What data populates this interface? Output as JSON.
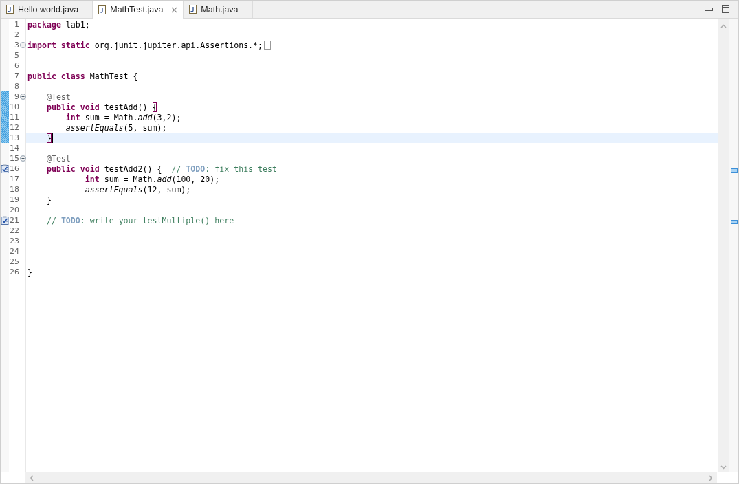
{
  "tabs": [
    {
      "label": "Hello world.java",
      "selected": false,
      "closable": false
    },
    {
      "label": "MathTest.java",
      "selected": true,
      "closable": true
    },
    {
      "label": "Math.java",
      "selected": false,
      "closable": false
    }
  ],
  "editor": {
    "lines": [
      {
        "number": "1",
        "tokens": [
          {
            "t": "package",
            "kind": "kw"
          },
          {
            "t": " lab1;",
            "kind": "plain"
          }
        ]
      },
      {
        "number": "2"
      },
      {
        "number": "3",
        "gutter": {
          "kind": "fold-collapsed"
        },
        "folded": true,
        "tokens": [
          {
            "t": "import",
            "kind": "kw"
          },
          {
            "t": " static",
            "kind": "kw"
          },
          {
            "t": " org.junit.jupiter.api.Assertions.*;",
            "kind": "plain"
          }
        ]
      },
      {
        "number": "5"
      },
      {
        "number": "6"
      },
      {
        "number": "7",
        "tokens": [
          {
            "t": "public",
            "kind": "kw"
          },
          {
            "t": " class",
            "kind": "kw"
          },
          {
            "t": " MathTest {",
            "kind": "plain"
          }
        ]
      },
      {
        "number": "8"
      },
      {
        "number": "9",
        "gutter": {
          "kind": "fold-expanded"
        },
        "changed": true,
        "tokens": [
          {
            "t": "    @Test",
            "kind": "ann"
          }
        ]
      },
      {
        "number": "10",
        "changed": true,
        "tokens": [
          {
            "t": "    public",
            "kind": "kw"
          },
          {
            "t": " void",
            "kind": "kw"
          },
          {
            "t": " testAdd() ",
            "kind": "plain"
          },
          {
            "t": "{",
            "kind": "bracket"
          }
        ]
      },
      {
        "number": "11",
        "changed": true,
        "tokens": [
          {
            "t": "        int",
            "kind": "kw"
          },
          {
            "t": " sum = Math.",
            "kind": "plain"
          },
          {
            "t": "add",
            "kind": "static"
          },
          {
            "t": "(3,2);",
            "kind": "plain"
          }
        ]
      },
      {
        "number": "12",
        "changed": true,
        "tokens": [
          {
            "t": "        assertEquals",
            "kind": "static"
          },
          {
            "t": "(5, sum);",
            "kind": "plain"
          }
        ]
      },
      {
        "number": "13",
        "changed": true,
        "current": true,
        "cursor": true,
        "tokens": [
          {
            "t": "    }",
            "kind": "bracket"
          }
        ]
      },
      {
        "number": "14"
      },
      {
        "number": "15",
        "gutter": {
          "kind": "fold-expanded"
        },
        "tokens": [
          {
            "t": "    @Test",
            "kind": "ann"
          }
        ]
      },
      {
        "number": "16",
        "gutter": {
          "kind": "task"
        },
        "tokens": [
          {
            "t": "    public",
            "kind": "kw"
          },
          {
            "t": " void",
            "kind": "kw"
          },
          {
            "t": " testAdd2() {  ",
            "kind": "plain"
          },
          {
            "t": "// ",
            "kind": "comment"
          },
          {
            "t": "TODO",
            "kind": "todo"
          },
          {
            "t": ": fix this test",
            "kind": "comment"
          }
        ]
      },
      {
        "number": "17",
        "tokens": [
          {
            "t": "            int",
            "kind": "kw"
          },
          {
            "t": " sum = Math.",
            "kind": "plain"
          },
          {
            "t": "add",
            "kind": "static"
          },
          {
            "t": "(100, 20);",
            "kind": "plain"
          }
        ]
      },
      {
        "number": "18",
        "tokens": [
          {
            "t": "            assertEquals",
            "kind": "static"
          },
          {
            "t": "(12, sum);",
            "kind": "plain"
          }
        ]
      },
      {
        "number": "19",
        "tokens": [
          {
            "t": "    }",
            "kind": "plain"
          }
        ]
      },
      {
        "number": "20"
      },
      {
        "number": "21",
        "gutter": {
          "kind": "task"
        },
        "tokens": [
          {
            "t": "    // ",
            "kind": "comment"
          },
          {
            "t": "TODO",
            "kind": "todo"
          },
          {
            "t": ": write your testMultiple() here",
            "kind": "comment"
          }
        ]
      },
      {
        "number": "22"
      },
      {
        "number": "23"
      },
      {
        "number": "24"
      },
      {
        "number": "25"
      },
      {
        "number": "26",
        "tokens": [
          {
            "t": "}",
            "kind": "plain"
          }
        ]
      }
    ]
  }
}
